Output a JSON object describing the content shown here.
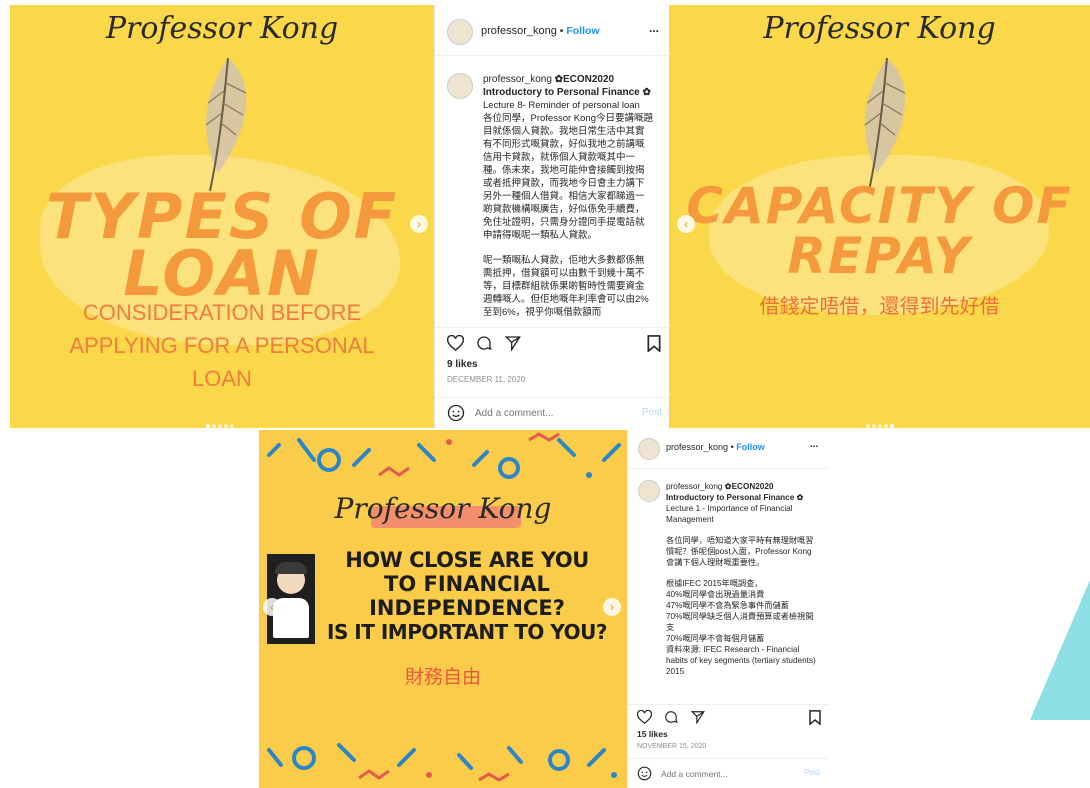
{
  "panel1": {
    "brand": "Professor Kong",
    "title_line1": "TYPES OF",
    "title_line2": "LOAN",
    "sub_line1": "CONSIDERATION BEFORE",
    "sub_line2": "APPLYING  FOR A PERSONAL",
    "sub_line3": "LOAN"
  },
  "post1": {
    "username": "professor_kong",
    "follow": "Follow",
    "dot": "•",
    "more": "...",
    "cap_user": "professor_kong",
    "cap_title1": "✿ECON2020",
    "cap_title2": "Introductory to Personal Finance ✿",
    "cap_lecture": "Lecture 8- Reminder of personal loan",
    "cap_p1": "各位同學，Professor Kong今日要講嘅題目就係個人貸款。我地日常生活中其實有不同形式嘅貸款，好似我地之前講嘅信用卡貸款，就係個人貸款嘅其中一種。係未來，我地可能仲會接觸到按揭或者抵押貸款，而我地今日會主力講下另外一種個人借貸。相信大家都睇過一啲貸款機構嘅廣告，好似係免手續費，免住址證明，只需身分證同手提電話就申請得嘅呢一類私人貸款。",
    "cap_p2": "呢一類嘅私人貸款，佢地大多數都係無需抵押，借貸額可以由數千到幾十萬不等，目標群組就係果啲暫時性需要資金週轉嘅人。但佢地嘅年利率會可以由2%至到6%，視乎你嘅借款額而",
    "likes": "9 likes",
    "date": "DECEMBER 11, 2020",
    "comment_placeholder": "Add a comment...",
    "post": "Post"
  },
  "panel2": {
    "brand": "Professor Kong",
    "title_line1": "CAPACITY OF",
    "title_line2": "REPAY",
    "sub": "借錢定唔借，還得到先好借"
  },
  "panel3": {
    "brand": "Professor Kong",
    "q1": "HOW CLOSE ARE YOU",
    "q2": "TO FINANCIAL",
    "q3": "INDEPENDENCE?",
    "q4": "IS IT IMPORTANT TO YOU?",
    "sub": "財務自由"
  },
  "post2": {
    "username": "professor_kong",
    "follow": "Follow",
    "dot": "•",
    "more": "...",
    "cap_user": "professor_kong",
    "cap_title1": "✿ECON2020",
    "cap_title2": "Introductory to Personal Finance ✿",
    "cap_lecture": "Lecture 1 - Importance of Financial Management",
    "cap_p1": "各位同學，唔知道大家平時有無理財嘅習慣呢？係呢個post入面，Professor Kong會講下個人理財嘅重要性。",
    "cap_l1": "根據IFEC 2015年嘅調查，",
    "cap_l2": "40%嘅同學會出現過量消費",
    "cap_l3": "47%嘅同學不會為緊急事件而儲蓄",
    "cap_l4": "70%嘅同學缺乏個人消費預算或者檢視開支",
    "cap_l5": "70%嘅同學不會每個月儲蓄",
    "cap_l6": "資料來源: IFEC Research - Financial habits of key segments (tertiary students) 2015",
    "likes": "15 likes",
    "date": "NOVEMBER 15, 2020",
    "comment_placeholder": "Add a comment...",
    "post": "Post"
  },
  "colors": {
    "yellow": "#fbd84a",
    "orange": "#f59a3c",
    "teal": "#8fe0e6",
    "link": "#1e90ff"
  }
}
